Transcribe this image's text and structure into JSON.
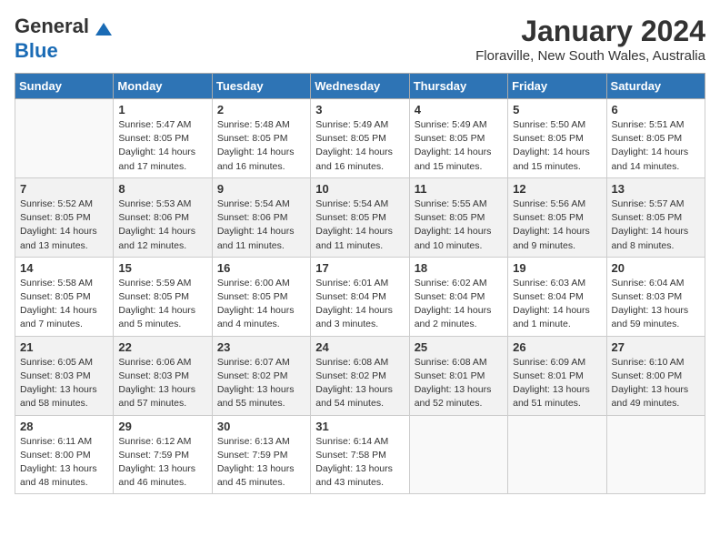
{
  "header": {
    "logo_line1": "General",
    "logo_line2": "Blue",
    "month_title": "January 2024",
    "location": "Floraville, New South Wales, Australia"
  },
  "days_of_week": [
    "Sunday",
    "Monday",
    "Tuesday",
    "Wednesday",
    "Thursday",
    "Friday",
    "Saturday"
  ],
  "weeks": [
    [
      {
        "num": "",
        "info": ""
      },
      {
        "num": "1",
        "info": "Sunrise: 5:47 AM\nSunset: 8:05 PM\nDaylight: 14 hours\nand 17 minutes."
      },
      {
        "num": "2",
        "info": "Sunrise: 5:48 AM\nSunset: 8:05 PM\nDaylight: 14 hours\nand 16 minutes."
      },
      {
        "num": "3",
        "info": "Sunrise: 5:49 AM\nSunset: 8:05 PM\nDaylight: 14 hours\nand 16 minutes."
      },
      {
        "num": "4",
        "info": "Sunrise: 5:49 AM\nSunset: 8:05 PM\nDaylight: 14 hours\nand 15 minutes."
      },
      {
        "num": "5",
        "info": "Sunrise: 5:50 AM\nSunset: 8:05 PM\nDaylight: 14 hours\nand 15 minutes."
      },
      {
        "num": "6",
        "info": "Sunrise: 5:51 AM\nSunset: 8:05 PM\nDaylight: 14 hours\nand 14 minutes."
      }
    ],
    [
      {
        "num": "7",
        "info": "Sunrise: 5:52 AM\nSunset: 8:05 PM\nDaylight: 14 hours\nand 13 minutes."
      },
      {
        "num": "8",
        "info": "Sunrise: 5:53 AM\nSunset: 8:06 PM\nDaylight: 14 hours\nand 12 minutes."
      },
      {
        "num": "9",
        "info": "Sunrise: 5:54 AM\nSunset: 8:06 PM\nDaylight: 14 hours\nand 11 minutes."
      },
      {
        "num": "10",
        "info": "Sunrise: 5:54 AM\nSunset: 8:05 PM\nDaylight: 14 hours\nand 11 minutes."
      },
      {
        "num": "11",
        "info": "Sunrise: 5:55 AM\nSunset: 8:05 PM\nDaylight: 14 hours\nand 10 minutes."
      },
      {
        "num": "12",
        "info": "Sunrise: 5:56 AM\nSunset: 8:05 PM\nDaylight: 14 hours\nand 9 minutes."
      },
      {
        "num": "13",
        "info": "Sunrise: 5:57 AM\nSunset: 8:05 PM\nDaylight: 14 hours\nand 8 minutes."
      }
    ],
    [
      {
        "num": "14",
        "info": "Sunrise: 5:58 AM\nSunset: 8:05 PM\nDaylight: 14 hours\nand 7 minutes."
      },
      {
        "num": "15",
        "info": "Sunrise: 5:59 AM\nSunset: 8:05 PM\nDaylight: 14 hours\nand 5 minutes."
      },
      {
        "num": "16",
        "info": "Sunrise: 6:00 AM\nSunset: 8:05 PM\nDaylight: 14 hours\nand 4 minutes."
      },
      {
        "num": "17",
        "info": "Sunrise: 6:01 AM\nSunset: 8:04 PM\nDaylight: 14 hours\nand 3 minutes."
      },
      {
        "num": "18",
        "info": "Sunrise: 6:02 AM\nSunset: 8:04 PM\nDaylight: 14 hours\nand 2 minutes."
      },
      {
        "num": "19",
        "info": "Sunrise: 6:03 AM\nSunset: 8:04 PM\nDaylight: 14 hours\nand 1 minute."
      },
      {
        "num": "20",
        "info": "Sunrise: 6:04 AM\nSunset: 8:03 PM\nDaylight: 13 hours\nand 59 minutes."
      }
    ],
    [
      {
        "num": "21",
        "info": "Sunrise: 6:05 AM\nSunset: 8:03 PM\nDaylight: 13 hours\nand 58 minutes."
      },
      {
        "num": "22",
        "info": "Sunrise: 6:06 AM\nSunset: 8:03 PM\nDaylight: 13 hours\nand 57 minutes."
      },
      {
        "num": "23",
        "info": "Sunrise: 6:07 AM\nSunset: 8:02 PM\nDaylight: 13 hours\nand 55 minutes."
      },
      {
        "num": "24",
        "info": "Sunrise: 6:08 AM\nSunset: 8:02 PM\nDaylight: 13 hours\nand 54 minutes."
      },
      {
        "num": "25",
        "info": "Sunrise: 6:08 AM\nSunset: 8:01 PM\nDaylight: 13 hours\nand 52 minutes."
      },
      {
        "num": "26",
        "info": "Sunrise: 6:09 AM\nSunset: 8:01 PM\nDaylight: 13 hours\nand 51 minutes."
      },
      {
        "num": "27",
        "info": "Sunrise: 6:10 AM\nSunset: 8:00 PM\nDaylight: 13 hours\nand 49 minutes."
      }
    ],
    [
      {
        "num": "28",
        "info": "Sunrise: 6:11 AM\nSunset: 8:00 PM\nDaylight: 13 hours\nand 48 minutes."
      },
      {
        "num": "29",
        "info": "Sunrise: 6:12 AM\nSunset: 7:59 PM\nDaylight: 13 hours\nand 46 minutes."
      },
      {
        "num": "30",
        "info": "Sunrise: 6:13 AM\nSunset: 7:59 PM\nDaylight: 13 hours\nand 45 minutes."
      },
      {
        "num": "31",
        "info": "Sunrise: 6:14 AM\nSunset: 7:58 PM\nDaylight: 13 hours\nand 43 minutes."
      },
      {
        "num": "",
        "info": ""
      },
      {
        "num": "",
        "info": ""
      },
      {
        "num": "",
        "info": ""
      }
    ]
  ]
}
